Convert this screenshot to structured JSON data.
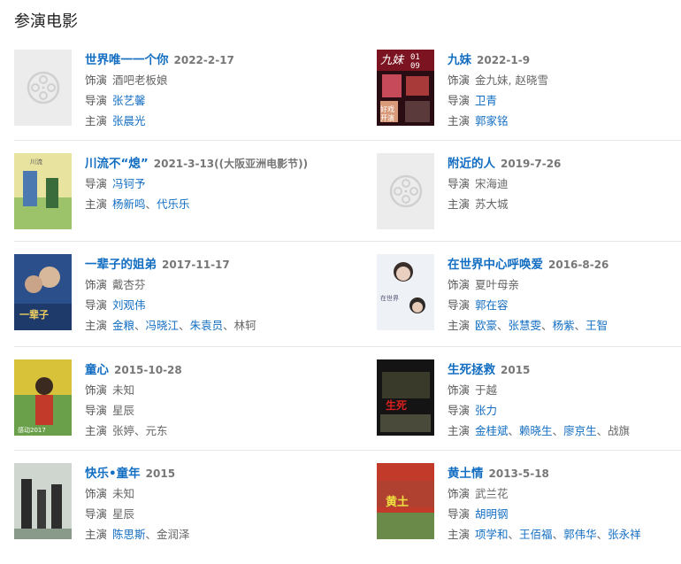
{
  "section_title": "参演电影",
  "labels": {
    "role": "饰演",
    "director": "导演",
    "cast": "主演"
  },
  "colors": {
    "link": "#136ec2",
    "divider": "#e6e6e6",
    "placeholder": "#ececec"
  },
  "movies": [
    {
      "title": "世界唯一一个你",
      "date": "2022-2-17",
      "role": "酒吧老板娘",
      "directors": [
        "张艺馨"
      ],
      "cast": [
        "张晨光"
      ],
      "poster": "placeholder-film-icon"
    },
    {
      "title": "九妹",
      "date": "2022-1-9",
      "role": "金九妹, 赵晓雪",
      "directors": [
        "卫青"
      ],
      "cast": [
        "郭家铭"
      ],
      "poster": "poster-jiumei"
    },
    {
      "title": "川流不“熄”",
      "date": "2021-3-13((大阪亚洲电影节))",
      "role": null,
      "directors": [
        "冯钶予"
      ],
      "cast": [
        "杨新鸣",
        "代乐乐"
      ],
      "poster": "poster-chuanliu"
    },
    {
      "title": "附近的人",
      "date": "2019-7-26",
      "role": null,
      "directors_plain": "宋海迪",
      "cast_plain": "苏大城",
      "poster": "placeholder-film-icon"
    },
    {
      "title": "一辈子的姐弟",
      "date": "2017-11-17",
      "role": "戴杏芬",
      "directors": [
        "刘观伟"
      ],
      "cast": [
        "金粮",
        "冯晓江",
        "朱袁员",
        "林轲"
      ],
      "cast_last_plain": true,
      "poster": "poster-yibeizi"
    },
    {
      "title": "在世界中心呼唤爱",
      "date": "2016-8-26",
      "role": "夏叶母亲",
      "directors": [
        "郭在容"
      ],
      "cast": [
        "欧豪",
        "张慧雯",
        "杨紫",
        "王智"
      ],
      "poster": "poster-zaishijie"
    },
    {
      "title": "童心",
      "date": "2015-10-28",
      "role": "未知",
      "directors_plain": "星辰",
      "cast_plain": "张婷、元东",
      "poster": "poster-tongxin"
    },
    {
      "title": "生死拯救",
      "date": "2015",
      "role": "于越",
      "directors": [
        "张力"
      ],
      "cast": [
        "金桂斌",
        "赖晓生",
        "廖京生"
      ],
      "cast_tail_plain": "战旗",
      "poster": "poster-shengsi"
    },
    {
      "title": "快乐•童年",
      "date": "2015",
      "role": "未知",
      "directors_plain": "星辰",
      "cast": [
        "陈思斯"
      ],
      "cast_tail_plain": "金润泽",
      "poster": "poster-kuaile"
    },
    {
      "title": "黄土情",
      "date": "2013-5-18",
      "role": "武兰花",
      "directors": [
        "胡明钢"
      ],
      "cast": [
        "项学和",
        "王佰福",
        "郭伟华",
        "张永祥"
      ],
      "poster": "poster-huangtu"
    }
  ]
}
